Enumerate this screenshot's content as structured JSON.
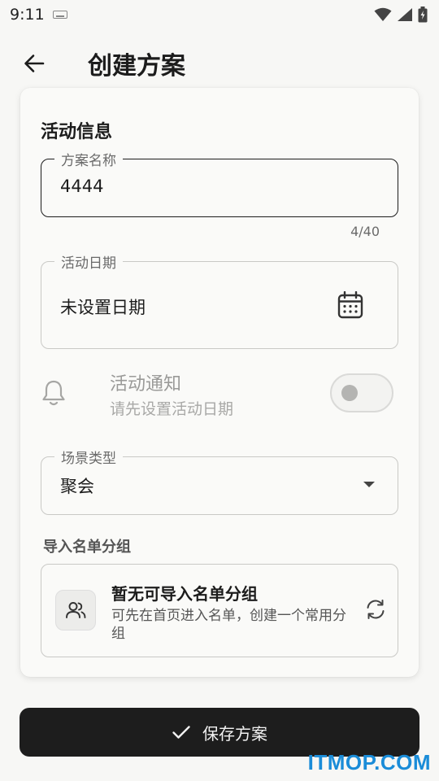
{
  "status_bar": {
    "time": "9:11"
  },
  "app_bar": {
    "title": "创建方案"
  },
  "card": {
    "section_title": "活动信息",
    "plan_name": {
      "label": "方案名称",
      "value": "4444",
      "counter": "4/40"
    },
    "activity_date": {
      "label": "活动日期",
      "value": "未设置日期"
    },
    "notification": {
      "title": "活动通知",
      "subtitle": "请先设置活动日期",
      "enabled": false
    },
    "scene_type": {
      "label": "场景类型",
      "value": "聚会"
    },
    "import_group": {
      "label": "导入名单分组",
      "empty_title": "暂无可导入名单分组",
      "empty_desc": "可先在首页进入名单，创建一个常用分组"
    }
  },
  "save_button": {
    "label": "保存方案"
  },
  "watermark": "ITMOP.COM",
  "colors": {
    "accent_dark": "#1d1d1d",
    "watermark": "#1a8cd8"
  }
}
